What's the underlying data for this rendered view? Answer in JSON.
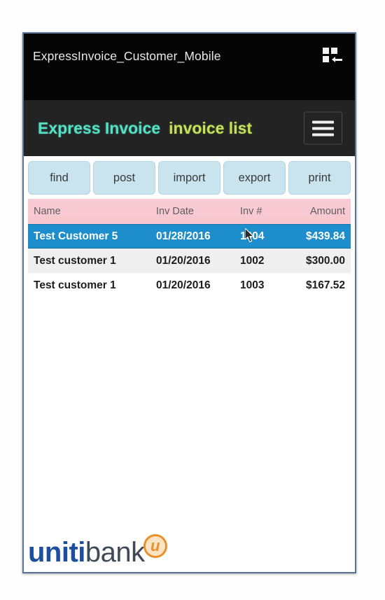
{
  "window": {
    "titlebar_text": "ExpressInvoice_Customer_Mobile",
    "titlebar_icon": "app-grid-restore-icon"
  },
  "header": {
    "brand": "Express Invoice",
    "page_title": "invoice list",
    "menu_icon": "hamburger-menu-icon",
    "brand_color": "#54e0c4",
    "title_color": "#c6e05a"
  },
  "toolbar": {
    "buttons": [
      {
        "label": "find"
      },
      {
        "label": "post"
      },
      {
        "label": "import"
      },
      {
        "label": "export"
      },
      {
        "label": "print"
      }
    ],
    "button_color": "#c9e4ee"
  },
  "table": {
    "header_color": "#f8c9d2",
    "selected_color": "#1e8dcb",
    "columns": [
      "Name",
      "Inv Date",
      "Inv #",
      "Amount"
    ],
    "rows": [
      {
        "name": "Test Customer 5",
        "date": "01/28/2016",
        "inv": "1004",
        "amount": "$439.84",
        "selected": true
      },
      {
        "name": "Test customer 1",
        "date": "01/20/2016",
        "inv": "1002",
        "amount": "$300.00",
        "selected": false
      },
      {
        "name": "Test customer 1",
        "date": "01/20/2016",
        "inv": "1003",
        "amount": "$167.52",
        "selected": false
      }
    ]
  },
  "footer": {
    "logo_primary": "uniti",
    "logo_secondary": "bank",
    "logo_badge_letter": "u",
    "logo_primary_color": "#1d4f9e",
    "logo_badge_color": "#e8912c"
  }
}
